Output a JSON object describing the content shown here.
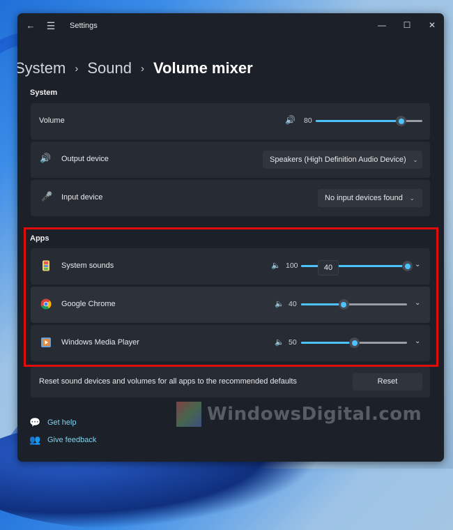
{
  "window": {
    "title": "Settings",
    "controls": {
      "minimize": "—",
      "maximize": "☐",
      "close": "✕"
    }
  },
  "breadcrumb": {
    "items": [
      "System",
      "Sound",
      "Volume mixer"
    ],
    "separator": "›"
  },
  "system_section": {
    "label": "System",
    "volume": {
      "label": "Volume",
      "value": "80",
      "percent": 80
    },
    "output_device": {
      "label": "Output device",
      "selected": "Speakers (High Definition Audio Device)"
    },
    "input_device": {
      "label": "Input device",
      "selected": "No input devices found"
    }
  },
  "apps_section": {
    "label": "Apps",
    "apps": [
      {
        "name": "System sounds",
        "value": "100",
        "percent": 100,
        "icon": "system-sounds-icon"
      },
      {
        "name": "Google Chrome",
        "value": "40",
        "percent": 40,
        "icon": "chrome-icon"
      },
      {
        "name": "Windows Media Player",
        "value": "50",
        "percent": 50,
        "icon": "media-player-icon"
      }
    ],
    "tooltip": "40"
  },
  "reset": {
    "description": "Reset sound devices and volumes for all apps to the recommended defaults",
    "button_label": "Reset"
  },
  "links": {
    "help": "Get help",
    "feedback": "Give feedback"
  },
  "watermark": "WindowsDigital.com",
  "colors": {
    "accent": "#4cc2ff",
    "highlight_frame": "#e10b0b",
    "link": "#7fd3f0"
  }
}
